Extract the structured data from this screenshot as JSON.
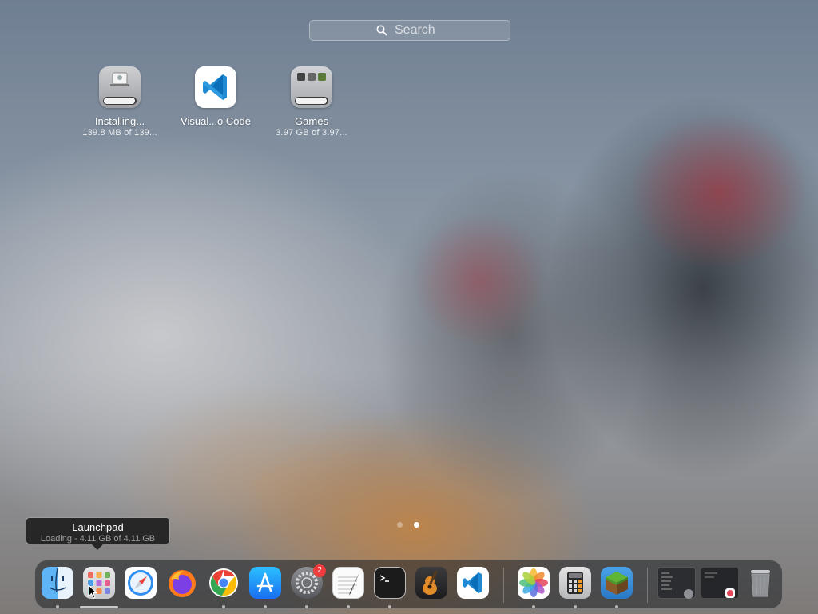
{
  "search": {
    "placeholder": "Search"
  },
  "apps": [
    {
      "name": "Installing...",
      "sub": "139.8 MB of 139...",
      "progress": 0.98
    },
    {
      "name": "Visual...o Code",
      "sub": ""
    },
    {
      "name": "Games",
      "sub": "3.97 GB of 3.97...",
      "progress": 0.98
    }
  ],
  "pages": {
    "count": 2,
    "current": 2
  },
  "tooltip": {
    "title": "Launchpad",
    "subtitle": "Loading - 4.11 GB of 4.11 GB"
  },
  "dock": {
    "apps": [
      {
        "name": "Finder",
        "icon": "finder-icon",
        "running": true
      },
      {
        "name": "Launchpad",
        "icon": "launchpad-icon",
        "running": true,
        "loading": true
      },
      {
        "name": "Safari",
        "icon": "safari-icon",
        "running": false
      },
      {
        "name": "Firefox",
        "icon": "firefox-icon",
        "running": false
      },
      {
        "name": "Google Chrome",
        "icon": "chrome-icon",
        "running": true
      },
      {
        "name": "App Store",
        "icon": "app-store-icon",
        "running": true
      },
      {
        "name": "System Settings",
        "icon": "system-settings-icon",
        "running": true,
        "badge": "2"
      },
      {
        "name": "TextEdit",
        "icon": "textedit-icon",
        "running": true
      },
      {
        "name": "Terminal",
        "icon": "terminal-icon",
        "running": true
      },
      {
        "name": "GarageBand",
        "icon": "garageband-icon",
        "running": false
      },
      {
        "name": "Visual Studio Code",
        "icon": "vscode-icon",
        "running": false
      },
      {
        "name": "Photos",
        "icon": "photos-icon",
        "running": true
      },
      {
        "name": "Calculator",
        "icon": "calculator-icon",
        "running": true
      },
      {
        "name": "Minecraft",
        "icon": "minecraft-icon",
        "running": true
      }
    ],
    "trash": {
      "name": "Trash",
      "icon": "trash-icon"
    }
  },
  "colors": {
    "badge": "#ef3c3c",
    "vscode_blue": "#0a7ad1"
  }
}
